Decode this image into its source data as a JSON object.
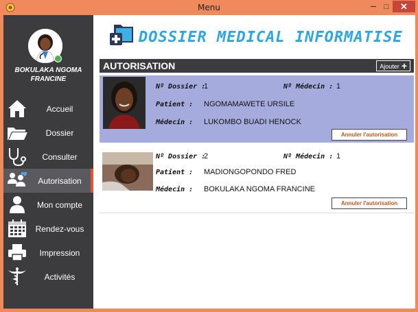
{
  "window": {
    "title": "Menu",
    "minimize": "–",
    "maximize": "□",
    "close": "✕"
  },
  "sidebar": {
    "user_name": "BOKULAKA NGOMA FRANCINE",
    "items": [
      {
        "label": "Accueil",
        "icon": "home-icon"
      },
      {
        "label": "Dossier",
        "icon": "folder-icon"
      },
      {
        "label": "Consulter",
        "icon": "stethoscope-icon"
      },
      {
        "label": "Autorisation",
        "icon": "users-icon",
        "active": true
      },
      {
        "label": "Mon compte",
        "icon": "user-icon"
      },
      {
        "label": "Rendez-vous",
        "icon": "calendar-icon"
      },
      {
        "label": "Impression",
        "icon": "printer-icon"
      },
      {
        "label": "Activités",
        "icon": "caduceus-icon"
      }
    ]
  },
  "main": {
    "app_title": "DOSSIER MEDICAL INFORMATISE",
    "header_title": "AUTORISATION",
    "add_label": "Ajouter",
    "labels": {
      "dossier": "Nº Dossier :",
      "medecin_no": "Nº Médecin :",
      "patient": "Patient :",
      "medecin": "Médecin :"
    },
    "cards": [
      {
        "dossier": "1",
        "medecin_no": "1",
        "patient": "NGOMAMAWETE URSILE",
        "medecin": "LUKOMBO BUADI HENOCK",
        "action": "Annuler l'autorisation"
      },
      {
        "dossier": "2",
        "medecin_no": "1",
        "patient": "MADIONGOPONDO FRED",
        "medecin": "BOKULAKA NGOMA FRANCINE",
        "action": "Annuler l'autorisation"
      }
    ]
  },
  "colors": {
    "accent": "#e0562f",
    "sidebar": "#3c3c3f",
    "selected_card": "#a6abdd",
    "title_blue": "#2fa6e0"
  }
}
